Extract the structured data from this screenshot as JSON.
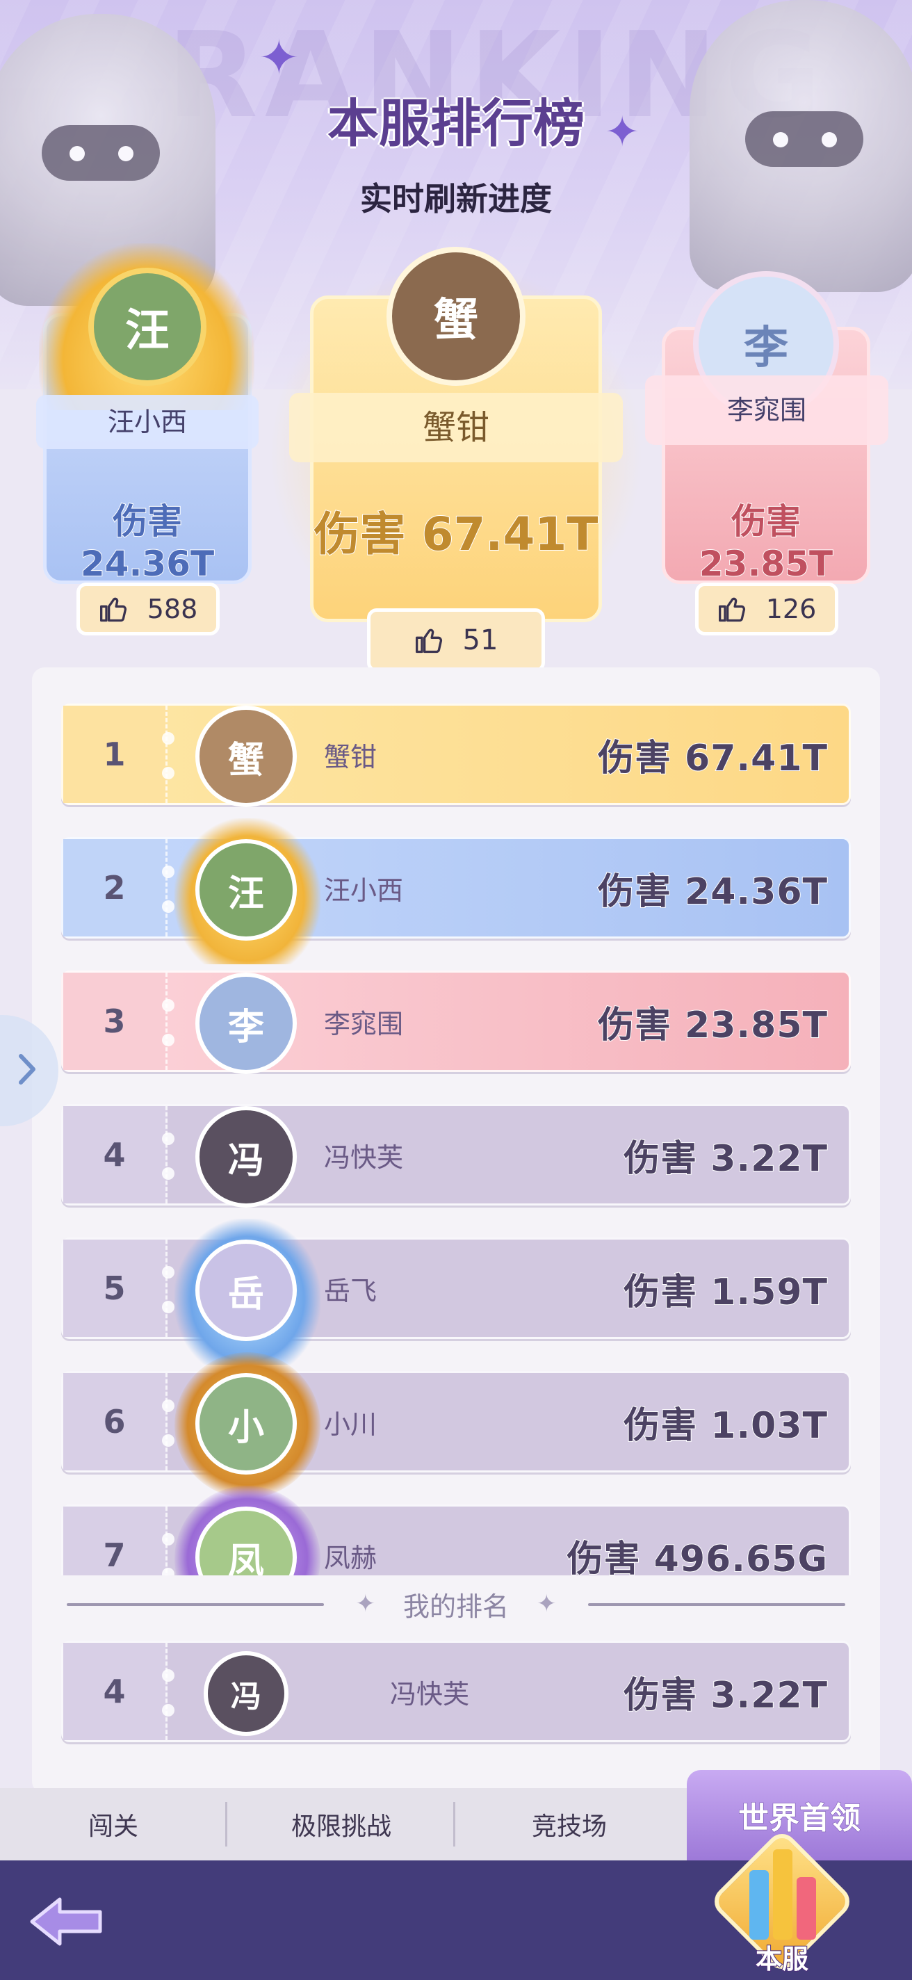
{
  "header": {
    "watermark": "RANKING",
    "title": "本服排行榜",
    "subtitle": "实时刷新进度"
  },
  "podium": [
    {
      "rank": 1,
      "name": "蟹钳",
      "damage": "伤害 67.41T",
      "likes": "51",
      "avatar_initial": "蟹",
      "color": "#fdd37a"
    },
    {
      "rank": 2,
      "name": "汪小西",
      "damage": "伤害 24.36T",
      "likes": "588",
      "avatar_initial": "汪",
      "color": "#a9c2f3"
    },
    {
      "rank": 3,
      "name": "李窕围",
      "damage": "伤害 23.85T",
      "likes": "126",
      "avatar_initial": "李",
      "color": "#f3a9b2"
    }
  ],
  "ranking_list": [
    {
      "rank": "1",
      "name": "蟹钳",
      "damage": "伤害 67.41T",
      "avatar_initial": "蟹"
    },
    {
      "rank": "2",
      "name": "汪小西",
      "damage": "伤害 24.36T",
      "avatar_initial": "汪"
    },
    {
      "rank": "3",
      "name": "李窕围",
      "damage": "伤害 23.85T",
      "avatar_initial": "李"
    },
    {
      "rank": "4",
      "name": "冯快芙",
      "damage": "伤害 3.22T",
      "avatar_initial": "冯"
    },
    {
      "rank": "5",
      "name": "岳飞",
      "damage": "伤害 1.59T",
      "avatar_initial": "岳"
    },
    {
      "rank": "6",
      "name": "小川",
      "damage": "伤害 1.03T",
      "avatar_initial": "小"
    },
    {
      "rank": "7",
      "name": "凤赫",
      "damage": "伤害 496.65G",
      "avatar_initial": "凤"
    }
  ],
  "my_rank": {
    "label": "我的排名",
    "rank": "4",
    "name": "冯快芙",
    "damage": "伤害 3.22T",
    "avatar_initial": "冯"
  },
  "tabs": [
    {
      "label": "闯关",
      "active": false
    },
    {
      "label": "极限挑战",
      "active": false
    },
    {
      "label": "竞技场",
      "active": false
    },
    {
      "label": "世界首领",
      "active": true
    }
  ],
  "footer": {
    "server_badge_label": "本服"
  },
  "icons": {
    "back": "arrow-left-icon",
    "likes": "thumbs-up-icon",
    "side": "chevron-right-icon"
  },
  "colors": {
    "gold": "#fdd37a",
    "blue": "#a9c2f3",
    "pink": "#f3a9b2",
    "lavender": "#d2c8e0",
    "footer": "#433c7a",
    "active_tab": "#9d79d8"
  }
}
